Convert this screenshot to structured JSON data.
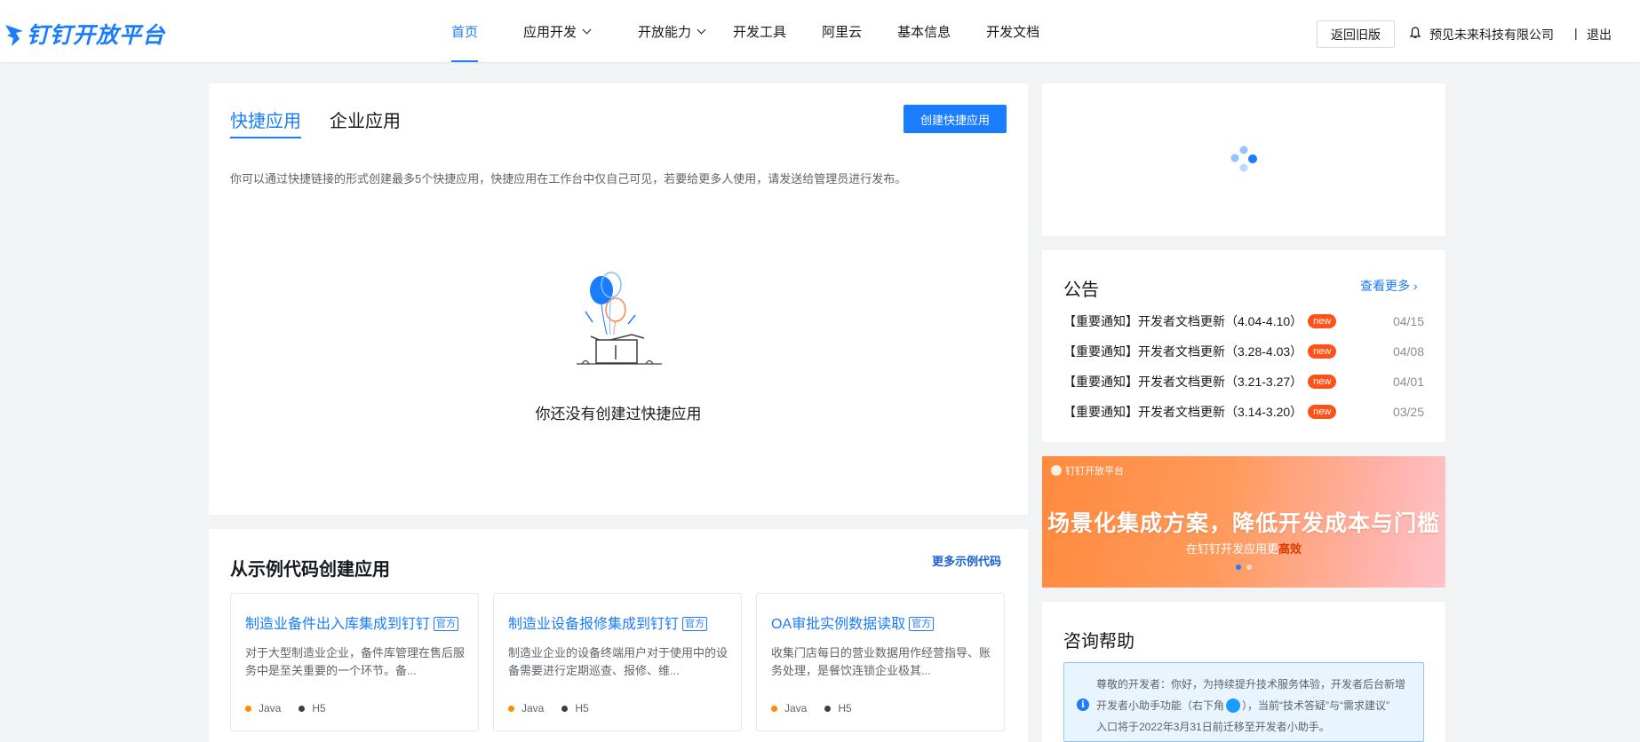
{
  "header": {
    "logo_text": "钉钉开放平台",
    "nav": [
      {
        "label": "首页",
        "active": true,
        "dropdown": false
      },
      {
        "label": "应用开发",
        "active": false,
        "dropdown": true
      },
      {
        "label": "开放能力",
        "active": false,
        "dropdown": true
      },
      {
        "label": "开发工具",
        "active": false,
        "dropdown": false
      },
      {
        "label": "阿里云",
        "active": false,
        "dropdown": false
      },
      {
        "label": "基本信息",
        "active": false,
        "dropdown": false
      },
      {
        "label": "开发文档",
        "active": false,
        "dropdown": false
      }
    ],
    "old_version_label": "返回旧版",
    "company": "预见未来科技有限公司",
    "separator": "|",
    "logout_label": "退出"
  },
  "quick_apps": {
    "tabs": [
      "快捷应用",
      "企业应用"
    ],
    "create_label": "创建快捷应用",
    "intro": "你可以通过快捷链接的形式创建最多5个快捷应用，快捷应用在工作台中仅自己可见，若要给更多人使用，请发送给管理员进行发布。",
    "empty_text": "你还没有创建过快捷应用"
  },
  "samples": {
    "title": "从示例代码创建应用",
    "more_label": "更多示例代码",
    "official_label": "官方",
    "items": [
      {
        "title": "制造业备件出入库集成到钉钉",
        "desc": "对于大型制造业企业，备件库管理在售后服务中是至关重要的一个环节。备...",
        "tags": [
          "Java",
          "H5"
        ]
      },
      {
        "title": "制造业设备报修集成到钉钉",
        "desc": "制造业企业的设备终端用户对于使用中的设备需要进行定期巡查、报修、维...",
        "tags": [
          "Java",
          "H5"
        ]
      },
      {
        "title": "OA审批实例数据读取",
        "desc": "收集门店每日的营业数据用作经营指导、账务处理，是餐饮连锁企业极其...",
        "tags": [
          "Java",
          "H5"
        ]
      }
    ],
    "tag_colors": {
      "Java": "#ff8a00",
      "H5": "#3c3f44"
    }
  },
  "notice": {
    "title": "公告",
    "more_label": "查看更多",
    "new_label": "new",
    "items": [
      {
        "text": "【重要通知】开发者文档更新（4.04-4.10）",
        "date": "04/15"
      },
      {
        "text": "【重要通知】开发者文档更新（3.28-4.03）",
        "date": "04/08"
      },
      {
        "text": "【重要通知】开发者文档更新（3.21-3.27）",
        "date": "04/01"
      },
      {
        "text": "【重要通知】开发者文档更新（3.14-3.20）",
        "date": "03/25"
      }
    ]
  },
  "banner": {
    "logo_text": "钉钉开放平台",
    "title": "场景化集成方案，降低开发成本与门槛",
    "sub_prefix": "在钉钉开发应用更",
    "sub_highlight": "高效"
  },
  "help": {
    "title": "咨询帮助",
    "line1": "尊敬的开发者：你好，为持续提升技术服务体验，开发者后台新增",
    "line2a": "开发者小助手功能（右下角",
    "line2b": "），当前“技术答疑”与“需求建议”",
    "line3": "入口将于2022年3月31日前迁移至开发者小助手。"
  }
}
